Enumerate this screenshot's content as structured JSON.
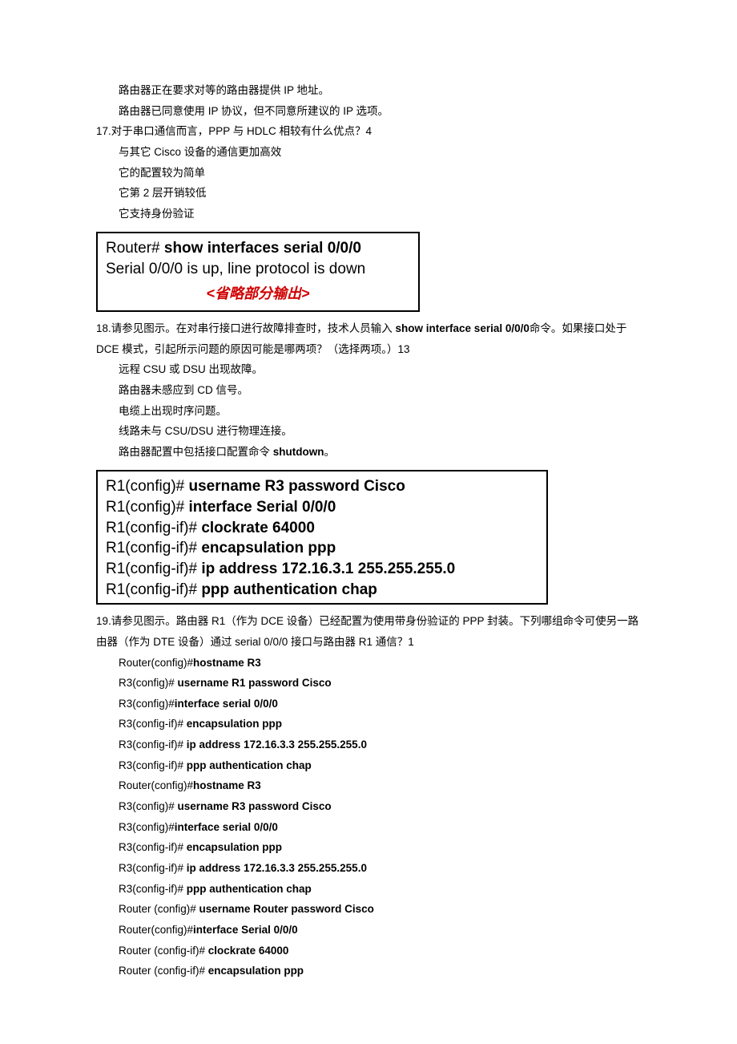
{
  "pre_options": [
    "路由器正在要求对等的路由器提供 IP 地址。",
    "路由器已同意使用 IP 协议，但不同意所建议的 IP 选项。"
  ],
  "q17": {
    "number": "17.",
    "text": "对于串口通信而言，PPP 与 HDLC 相较有什么优点？4",
    "options": [
      "与其它 Cisco 设备的通信更加高效",
      "它的配置较为简单",
      "它第 2 层开销较低",
      "它支持身份验证"
    ]
  },
  "exhibit18": {
    "l1_prefix": "Router# ",
    "l1_bold": "show interfaces serial 0/0/0",
    "l2": "Serial 0/0/0 is up, line protocol is down",
    "note": "<省略部分输出>"
  },
  "q18": {
    "number": "18.",
    "text_a": "请参见图示。在对串行接口进行故障排查时，技术人员输入 ",
    "text_bold": "show interface serial 0/0/0",
    "text_b": "命令。如果接口处于 DCE 模式，引起所示问题的原因可能是哪两项？（选择两项。）13",
    "options_plain": [
      "远程 CSU 或 DSU 出现故障。",
      "路由器未感应到 CD 信号。",
      "电缆上出现时序问题。",
      "线路未与 CSU/DSU 进行物理连接。"
    ],
    "opt5_a": "路由器配置中包括接口配置命令 ",
    "opt5_bold": "shutdown",
    "opt5_b": "。"
  },
  "exhibit19": {
    "lines": [
      {
        "p": "R1(config)# ",
        "b": "username R3 password Cisco"
      },
      {
        "p": "R1(config)# ",
        "b": "interface Serial 0/0/0"
      },
      {
        "p": "R1(config-if)# ",
        "b": "clockrate 64000"
      },
      {
        "p": "R1(config-if)# ",
        "b": "encapsulation ppp"
      },
      {
        "p": "R1(config-if)# ",
        "b": "ip address 172.16.3.1 255.255.255.0"
      },
      {
        "p": "R1(config-if)# ",
        "b": "ppp authentication chap"
      }
    ]
  },
  "q19": {
    "number": "19.",
    "text": "请参见图示。路由器 R1（作为 DCE 设备）已经配置为使用带身份验证的 PPP 封装。下列哪组命令可使另一路由器（作为 DTE 设备）通过 serial 0/0/0 接口与路由器 R1 通信？1",
    "cmds": [
      {
        "p": "Router(config)#",
        "b": "hostname R3"
      },
      {
        "p": "R3(config)# ",
        "b": "username R1 password Cisco"
      },
      {
        "p": "R3(config)#",
        "b": "interface serial 0/0/0"
      },
      {
        "p": "R3(config-if)# ",
        "b": "encapsulation ppp"
      },
      {
        "p": "R3(config-if)# ",
        "b": "ip address 172.16.3.3 255.255.255.0"
      },
      {
        "p": "R3(config-if)# ",
        "b": "ppp authentication chap"
      },
      {
        "p": "Router(config)#",
        "b": "hostname R3"
      },
      {
        "p": "R3(config)# ",
        "b": "username R3 password Cisco"
      },
      {
        "p": "R3(config)#",
        "b": "interface serial 0/0/0"
      },
      {
        "p": "R3(config-if)# ",
        "b": "encapsulation ppp"
      },
      {
        "p": "R3(config-if)# ",
        "b": "ip address 172.16.3.3 255.255.255.0"
      },
      {
        "p": "R3(config-if)# ",
        "b": "ppp authentication chap"
      },
      {
        "p": "Router (config)# ",
        "b": "username Router password Cisco"
      },
      {
        "p": "Router(config)#",
        "b": "interface Serial 0/0/0"
      },
      {
        "p": "Router (config-if)# ",
        "b": "clockrate 64000"
      },
      {
        "p": "Router (config-if)# ",
        "b": "encapsulation ppp"
      }
    ]
  }
}
